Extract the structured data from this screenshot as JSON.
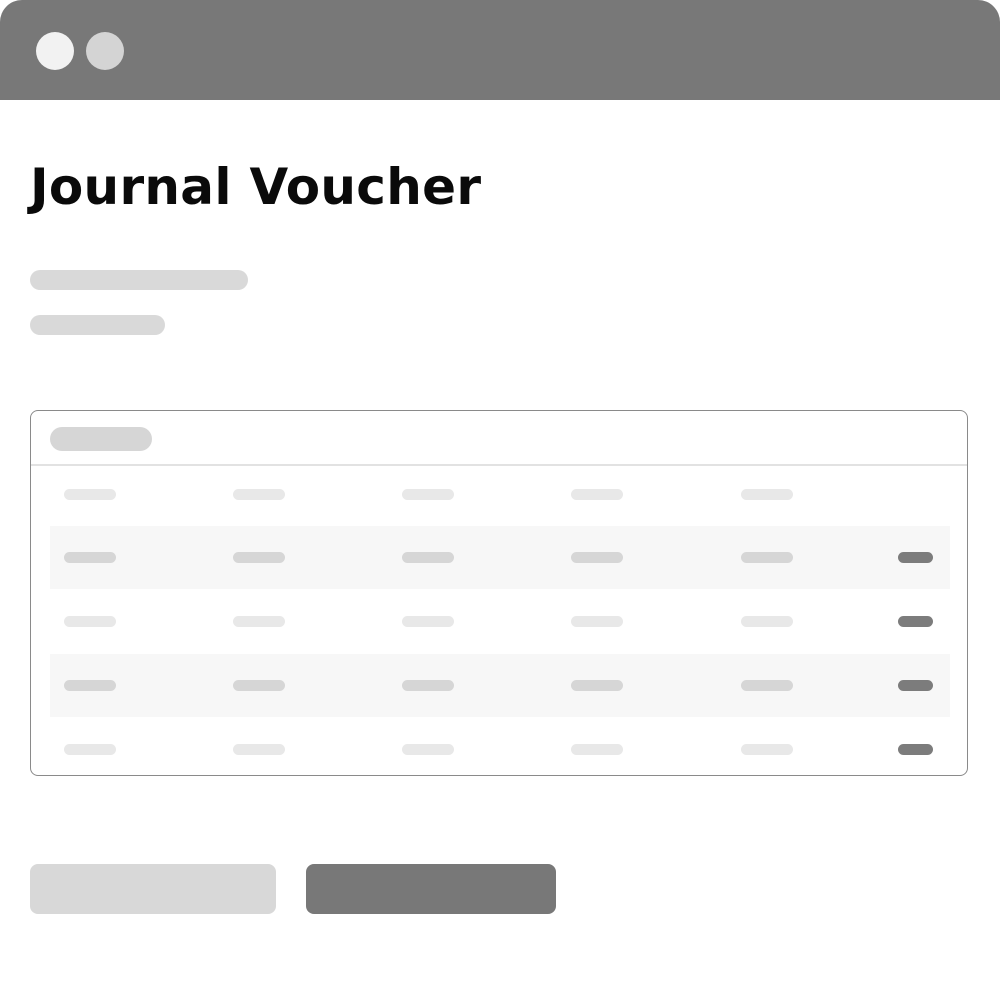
{
  "window": {
    "title_controls": [
      "window-dot",
      "window-dot"
    ]
  },
  "page": {
    "title": "Journal Voucher"
  },
  "table": {
    "rows": [
      {
        "style": "light",
        "has_action": false
      },
      {
        "style": "alt",
        "has_action": true
      },
      {
        "style": "light",
        "has_action": true
      },
      {
        "style": "alt",
        "has_action": true
      },
      {
        "style": "light",
        "has_action": true
      }
    ]
  },
  "buttons": {
    "secondary_label": "",
    "primary_label": ""
  },
  "colors": {
    "titlebar": "#787878",
    "accent": "#787878",
    "skeleton": "#d9d9d9"
  }
}
